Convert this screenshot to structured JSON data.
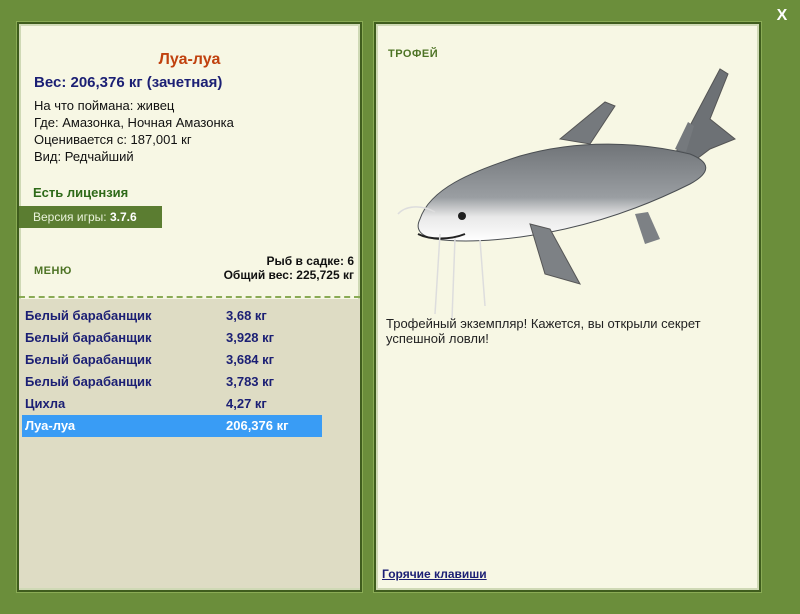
{
  "fish": {
    "name": "Луа-луа",
    "weight_line": "Вес: 206,376 кг (зачетная)",
    "caught_on": "На что поймана: живец",
    "where": "Где: Амазонка, Ночная Амазонка",
    "valued_from": "Оценивается с: 187,001 кг",
    "type": "Вид: Редчайший"
  },
  "license": "Есть лицензия",
  "version": {
    "label": "Версия игры:",
    "value": "3.7.6"
  },
  "menu_label": "МЕНЮ",
  "stats": {
    "in_keepnet": "Рыб в садке: 6",
    "total_weight": "Общий вес: 225,725 кг"
  },
  "catch_list": [
    {
      "name": "Белый барабанщик",
      "weight": "3,68 кг",
      "selected": false
    },
    {
      "name": "Белый барабанщик",
      "weight": "3,928 кг",
      "selected": false
    },
    {
      "name": "Белый барабанщик",
      "weight": "3,684 кг",
      "selected": false
    },
    {
      "name": "Белый барабанщик",
      "weight": "3,783 кг",
      "selected": false
    },
    {
      "name": "Цихла",
      "weight": "4,27 кг",
      "selected": false
    },
    {
      "name": "Луа-луа",
      "weight": "206,376 кг",
      "selected": true
    }
  ],
  "trophy_label": "ТРОФЕЙ",
  "description": "Трофейный экземпляр! Кажется, вы открыли секрет успешной ловли!",
  "hotkeys_link": "Горячие клавиши",
  "close_glyph": "X",
  "colors": {
    "background": "#6b8e3b",
    "panel": "#f7f7e4",
    "fish_name": "#c0410e",
    "text_navy": "#1b1f74",
    "selected": "#399cf5"
  }
}
